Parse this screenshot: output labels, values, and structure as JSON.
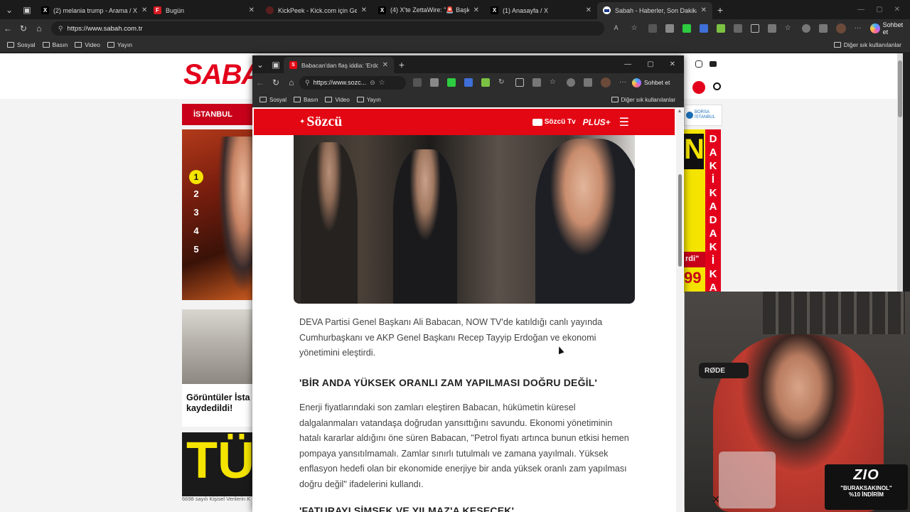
{
  "main_browser": {
    "tabs": [
      {
        "label": "(2) melania trump - Arama / X",
        "icon": "x-logo-icon"
      },
      {
        "label": "Bugün",
        "icon": "f-logo-icon"
      },
      {
        "label": "KickPeek - Kick.com için Gerçek Za",
        "icon": "kickpeek-icon"
      },
      {
        "label": "(4) X'te ZettaWire: \"🚨 Başkan Yar",
        "icon": "x-logo-icon"
      },
      {
        "label": "(1) Anasayfa / X",
        "icon": "x-logo-icon"
      },
      {
        "label": "Sabah - Haberler, Son Dakika Hab",
        "icon": "sabah-icon"
      }
    ],
    "url": "https://www.sabah.com.tr",
    "bookmarks": [
      "Sosyal",
      "Basın",
      "Video",
      "Yayın"
    ],
    "other_bookmarks": "Diğer sık kullanılanlar",
    "chat_button": "Sohbet et"
  },
  "sabah_page": {
    "logo": "SABAH",
    "city_tab": "İSTANBUL",
    "rank_numbers": [
      "1",
      "2",
      "3",
      "4",
      "5"
    ],
    "story_caption": "Görüntüler İsta kaydedildi!",
    "footer_text": "6698 sayılı Kişisel Verilerin K",
    "borsa": "BORSA İSTANBUL",
    "breaking_letters": [
      "D",
      "A",
      "K",
      "İ",
      "K",
      "A",
      "D",
      "A",
      "K",
      "İ",
      "K",
      "A"
    ],
    "banner_snippet": "N",
    "banner_number": "99",
    "banner_quote": "rdi\""
  },
  "popup_browser": {
    "tab_title": "Babacan'dan flaş iddia: 'Erdoğan b",
    "url": "https://www.sozc...",
    "bookmarks": [
      "Sosyal",
      "Basın",
      "Video",
      "Yayın"
    ],
    "other_bookmarks": "Diğer sık kullanılanlar",
    "chat_button": "Sohbet et"
  },
  "sozcu": {
    "logo": "Sözcü",
    "tv_label": "Sözcü Tv",
    "plus_label": "PLUS+",
    "paragraph1": "DEVA Partisi Genel Başkanı Ali Babacan, NOW TV'de katıldığı canlı yayında Cumhurbaşkanı ve AKP Genel Başkanı Recep Tayyip Erdoğan ve ekonomi yönetimini eleştirdi.",
    "heading1": "'BİR ANDA YÜKSEK ORANLI ZAM YAPILMASI DOĞRU DEĞİL'",
    "paragraph2": "Enerji fiyatlarındaki son zamları eleştiren Babacan, hükümetin küresel dalgalanmaları vatandaşa doğrudan yansıttığını savundu. Ekonomi yönetiminin hatalı kararlar aldığını öne süren Babacan, \"Petrol fiyatı artınca bunun etkisi hemen pompaya yansıtılmamalı. Zamlar sınırlı tutulmalı ve zamana yayılmalı. Yüksek enflasyon hedefi olan bir ekonomide enerjiye bir anda yüksek oranlı zam yapılması doğru değil\" ifadelerini kullandı.",
    "heading2": "'FATURAYI ŞİMŞEK VE YILMAZ'A KESECEK'"
  },
  "overlay": {
    "brand": "ZIO",
    "promo_code": "\"BURAKSAKINOL\"",
    "promo_discount": "%10 İNDİRİM",
    "mic_brand": "RØDE"
  },
  "colors": {
    "sozcu_red": "#e30613",
    "sabah_red": "#e3001b",
    "breaking_yellow": "#f5e400"
  }
}
